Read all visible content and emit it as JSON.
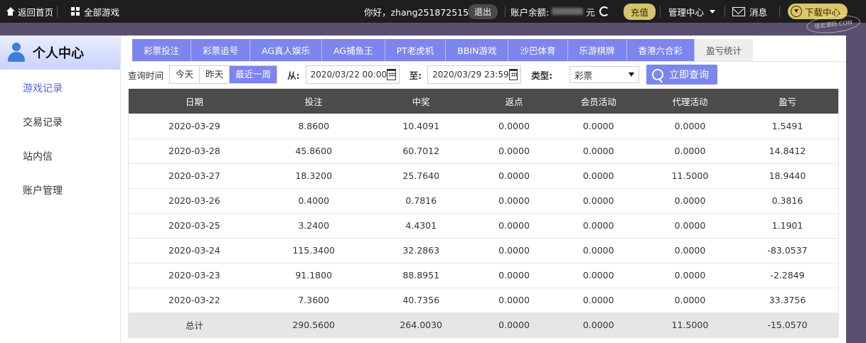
{
  "topbar": {
    "home": "返回首页",
    "all_games": "全部游戏",
    "greeting": "你好，zhang251872515",
    "logout": "退出",
    "balance_label": "账户余额:",
    "currency": "元",
    "recharge": "充值",
    "manage": "管理中心",
    "messages": "消息",
    "download": "下载中心",
    "watermark": "佳宏源码.COM"
  },
  "sidebar": {
    "title": "个人中心",
    "items": [
      {
        "label": "游戏记录",
        "active": true
      },
      {
        "label": "交易记录",
        "active": false
      },
      {
        "label": "站内信",
        "active": false
      },
      {
        "label": "账户管理",
        "active": false
      }
    ]
  },
  "tabs": [
    {
      "label": "彩票投注"
    },
    {
      "label": "彩票追号"
    },
    {
      "label": "AG真人娱乐"
    },
    {
      "label": "AG捕鱼王"
    },
    {
      "label": "PT老虎机"
    },
    {
      "label": "BBIN游戏"
    },
    {
      "label": "沙巴体育"
    },
    {
      "label": "乐游棋牌"
    },
    {
      "label": "香港六合彩"
    },
    {
      "label": "盈亏统计",
      "active": true
    }
  ],
  "query": {
    "time_label": "查询时间",
    "today": "今天",
    "yesterday": "昨天",
    "last_week": "最近一周",
    "from_label": "从:",
    "from_value": "2020/03/22 00:00",
    "to_label": "至:",
    "to_value": "2020/03/29 23:59",
    "type_label": "类型:",
    "type_value": "彩票",
    "submit": "立即查询"
  },
  "table": {
    "headers": [
      "日期",
      "投注",
      "中奖",
      "返点",
      "会员活动",
      "代理活动",
      "盈亏"
    ],
    "rows": [
      [
        "2020-03-29",
        "8.8600",
        "10.4091",
        "0.0000",
        "0.0000",
        "0.0000",
        "1.5491"
      ],
      [
        "2020-03-28",
        "45.8600",
        "60.7012",
        "0.0000",
        "0.0000",
        "0.0000",
        "14.8412"
      ],
      [
        "2020-03-27",
        "18.3200",
        "25.7640",
        "0.0000",
        "0.0000",
        "11.5000",
        "18.9440"
      ],
      [
        "2020-03-26",
        "0.4000",
        "0.7816",
        "0.0000",
        "0.0000",
        "0.0000",
        "0.3816"
      ],
      [
        "2020-03-25",
        "3.2400",
        "4.4301",
        "0.0000",
        "0.0000",
        "0.0000",
        "1.1901"
      ],
      [
        "2020-03-24",
        "115.3400",
        "32.2863",
        "0.0000",
        "0.0000",
        "0.0000",
        "-83.0537"
      ],
      [
        "2020-03-23",
        "91.1800",
        "88.8951",
        "0.0000",
        "0.0000",
        "0.0000",
        "-2.2849"
      ],
      [
        "2020-03-22",
        "7.3600",
        "40.7356",
        "0.0000",
        "0.0000",
        "0.0000",
        "33.3756"
      ]
    ],
    "total": [
      "总计",
      "290.5600",
      "264.0030",
      "0.0000",
      "0.0000",
      "11.5000",
      "-15.0570"
    ]
  }
}
